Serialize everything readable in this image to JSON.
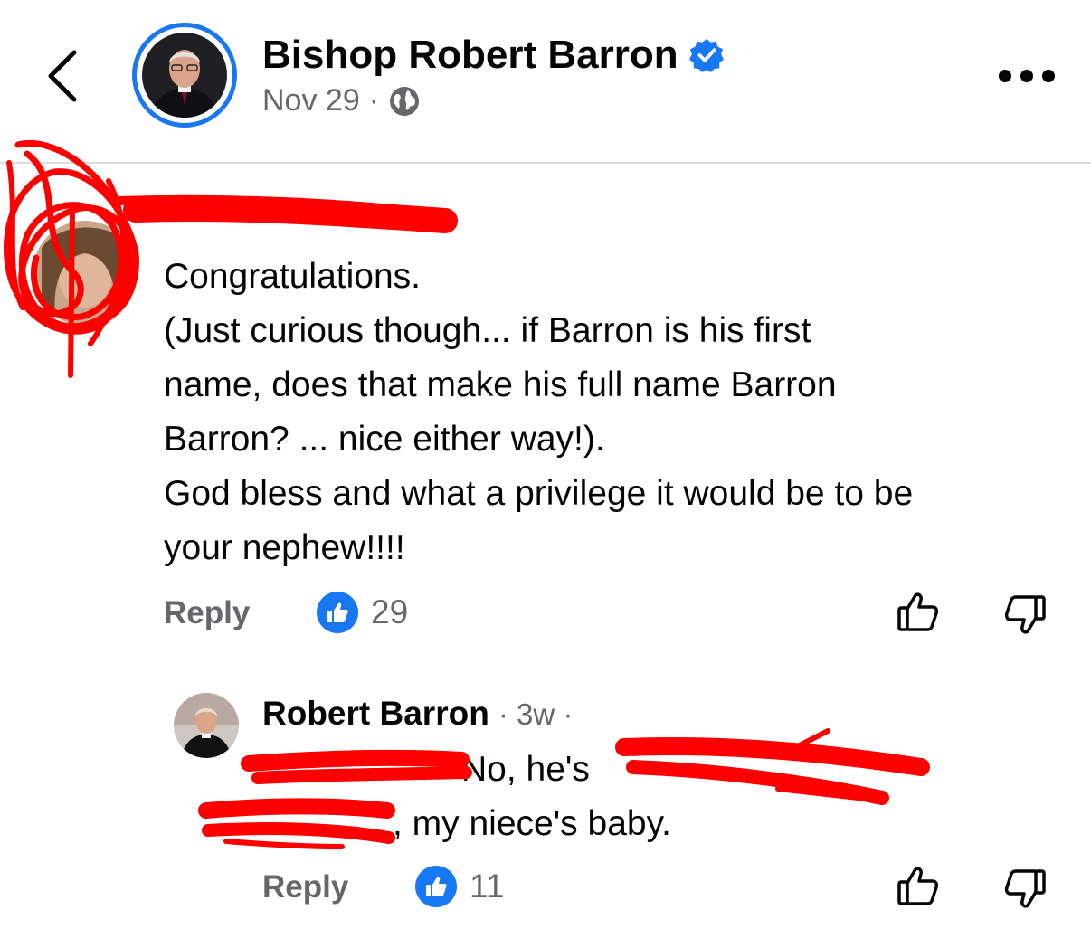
{
  "header": {
    "page_name": "Bishop Robert Barron",
    "post_date": "Nov 29",
    "separator": "·"
  },
  "comment": {
    "lines": [
      "Congratulations.",
      "(Just curious though... if Barron is his first",
      "name, does that make his full name Barron",
      "Barron? ... nice either way!).",
      "God bless and what a privilege it would be to be",
      "your nephew!!!!"
    ],
    "reply_label": "Reply",
    "like_count": "29"
  },
  "reply": {
    "author": "Robert Barron",
    "meta": "· 3w ·",
    "line1_text": "No, he's",
    "line2_text": ", my niece's baby.",
    "reply_label": "Reply",
    "like_count": "11"
  },
  "colors": {
    "accent": "#1877f2",
    "secondary_text": "#65676b",
    "redaction": "#ff0000"
  }
}
